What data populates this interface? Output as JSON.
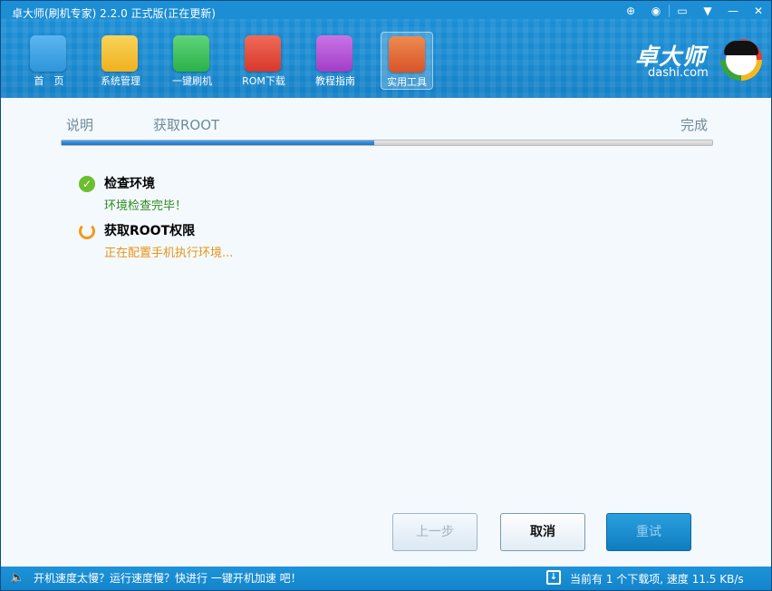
{
  "window": {
    "title": "卓大师(刷机专家) 2.2.0 正式版(正在更新)"
  },
  "titlebar_icons": [
    {
      "name": "search-icon",
      "glyph": "⊕"
    },
    {
      "name": "weibo-icon",
      "glyph": "◉"
    },
    {
      "name": "feedback-icon",
      "glyph": "▭"
    },
    {
      "name": "menu-icon",
      "glyph": "▼"
    },
    {
      "name": "minimize-icon",
      "glyph": "—"
    },
    {
      "name": "close-icon",
      "glyph": "✕"
    }
  ],
  "toolbar": [
    {
      "label": "首　页",
      "icon": "home-icon",
      "color": "#2f95db"
    },
    {
      "label": "系统管理",
      "icon": "toolbox-icon",
      "color": "#f0b11f"
    },
    {
      "label": "一键刷机",
      "icon": "refresh-icon",
      "color": "#2bb24a"
    },
    {
      "label": "ROM下载",
      "icon": "cart-icon",
      "color": "#d8382b"
    },
    {
      "label": "教程指南",
      "icon": "notebook-icon",
      "color": "#a33ec8"
    },
    {
      "label": "实用工具",
      "icon": "tools-icon",
      "color": "#d8542a",
      "active": true
    }
  ],
  "logo": {
    "cn": "卓大师",
    "en": "dashi.com"
  },
  "steps": {
    "items": [
      "说明",
      "获取ROOT",
      "完成"
    ],
    "progress_percent": 48
  },
  "status": [
    {
      "title": "检查环境",
      "detail": "环境检查完毕！",
      "state": "done",
      "color": "#2c8a1e"
    },
    {
      "title": "获取ROOT权限",
      "detail": "正在配置手机执行环境...",
      "state": "running",
      "color": "#e69516"
    }
  ],
  "buttons": {
    "prev": "上一步",
    "cancel": "取消",
    "retry": "重试"
  },
  "footer": {
    "message": "开机速度太慢？运行速度慢？快进行 一键开机加速 吧！",
    "download_status": "当前有 1 个下载项, 速度 11.5 KB/s"
  }
}
